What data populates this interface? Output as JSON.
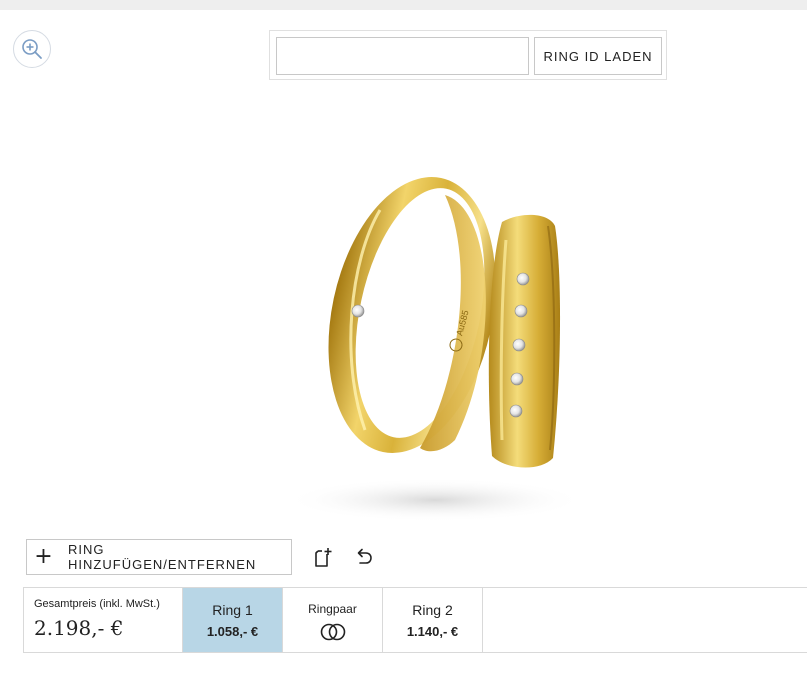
{
  "search": {
    "value": "",
    "placeholder": "",
    "load_label": "RING ID LADEN"
  },
  "controls": {
    "add_remove_label": "RING HINZUFÜGEN/ENTFERNEN",
    "plus_symbol": "+"
  },
  "ring_engraving": "Au585",
  "summary": {
    "total_label": "Gesamtpreis (inkl. MwSt.)",
    "total_value": "2.198,- €",
    "ring1": {
      "name": "Ring 1",
      "price": "1.058,- €",
      "selected": true
    },
    "pair": {
      "name": "Ringpaar",
      "icon": "rings-icon"
    },
    "ring2": {
      "name": "Ring 2",
      "price": "1.140,- €",
      "selected": false
    }
  },
  "colors": {
    "accent": "#b8d6e6",
    "gold": "#d9b23a",
    "border": "#d9d9d9"
  }
}
